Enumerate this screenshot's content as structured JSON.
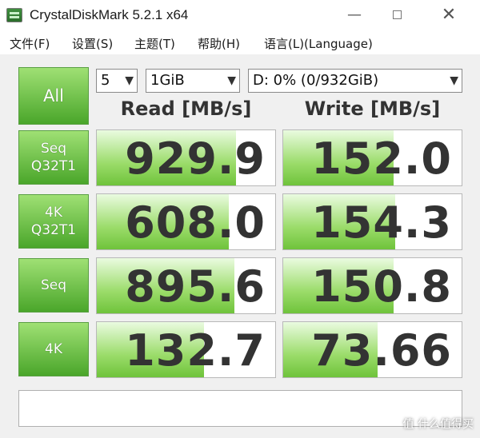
{
  "window": {
    "title": "CrystalDiskMark 5.2.1 x64"
  },
  "menu": [
    "文件(F)",
    "设置(S)",
    "主题(T)",
    "帮助(H)",
    "语言(L)(Language)"
  ],
  "controls": {
    "all_label": "All",
    "count": "5",
    "size": "1GiB",
    "drive": "D: 0% (0/932GiB)"
  },
  "headers": {
    "read": "Read [MB/s]",
    "write": "Write [MB/s]"
  },
  "tests": [
    {
      "line1": "Seq",
      "line2": "Q32T1",
      "read": "929.9",
      "write": "152.0",
      "read_fill": 0.78,
      "write_fill": 0.62
    },
    {
      "line1": "4K",
      "line2": "Q32T1",
      "read": "608.0",
      "write": "154.3",
      "read_fill": 0.74,
      "write_fill": 0.63
    },
    {
      "line1": "Seq",
      "line2": "",
      "read": "895.6",
      "write": "150.8",
      "read_fill": 0.77,
      "write_fill": 0.62
    },
    {
      "line1": "4K",
      "line2": "",
      "read": "132.7",
      "write": "73.66",
      "read_fill": 0.6,
      "write_fill": 0.53
    }
  ],
  "comment": "",
  "watermark": "值 什么值得买"
}
